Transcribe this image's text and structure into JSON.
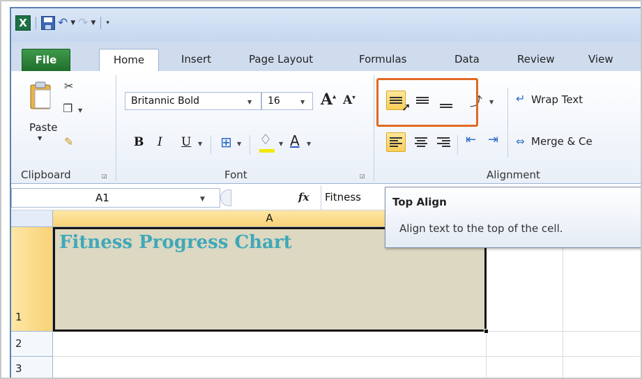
{
  "quick_access": {
    "app_icon": "excel-icon",
    "save_icon": "save-icon",
    "undo_icon": "undo-icon",
    "redo_icon": "redo-icon",
    "customize_icon": "customize-qat-icon"
  },
  "tabs": {
    "file": "File",
    "home": "Home",
    "insert": "Insert",
    "page_layout": "Page Layout",
    "formulas": "Formulas",
    "data": "Data",
    "review": "Review",
    "view": "View"
  },
  "clipboard": {
    "paste_label": "Paste",
    "group_label": "Clipboard"
  },
  "font": {
    "font_name": "Britannic Bold",
    "font_size": "16",
    "bold": "B",
    "italic": "I",
    "underline": "U",
    "font_color_label": "A",
    "grow_label": "A",
    "shrink_label": "A",
    "group_label": "Font"
  },
  "alignment": {
    "wrap_text": "Wrap Text",
    "merge_center": "Merge & Ce",
    "group_label": "Alignment",
    "active_button": "top-align"
  },
  "formula_bar": {
    "name_box": "A1",
    "fx_label": "fx",
    "content": "Fitness"
  },
  "tooltip": {
    "title": "Top Align",
    "description": "Align text to the top of the cell."
  },
  "grid": {
    "column_headers": [
      "A"
    ],
    "row_headers": [
      "1",
      "2",
      "3"
    ],
    "cell_a1": "Fitness Progress Chart",
    "cell_a1_color": "#3fa8b8",
    "cell_a1_fill": "#dcd8c2"
  },
  "colors": {
    "file_tab": "#2a7d36",
    "highlight": "#f7cf5a",
    "callout_border": "#e06a22"
  }
}
